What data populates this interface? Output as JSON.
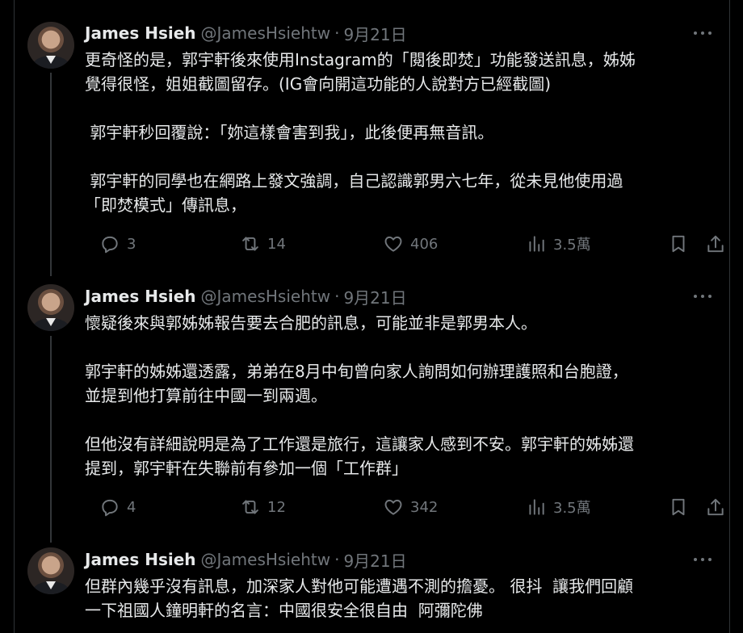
{
  "tweets": [
    {
      "name": "James Hsieh",
      "handle": "@JamesHsiehtw",
      "separator": "·",
      "time": "9月21日",
      "text": "更奇怪的是，郭宇軒後來使用Instagram的「閱後即焚」功能發送訊息，姊姊\n覺得很怪，姐姐截圖留存。(IG會向開這功能的人說對方已經截圖)\n\n 郭宇軒秒回覆說：「妳這樣會害到我」，此後便再無音訊。\n\n 郭宇軒的同學也在網路上發文強調，自己認識郭男六七年，從未見他使用過\n「即焚模式」傳訊息，",
      "replies": "3",
      "retweets": "14",
      "likes": "406",
      "views": "3.5萬"
    },
    {
      "name": "James Hsieh",
      "handle": "@JamesHsiehtw",
      "separator": "·",
      "time": "9月21日",
      "text": "懷疑後來與郭姊姊報告要去合肥的訊息，可能並非是郭男本人。\n\n郭宇軒的姊姊還透露，弟弟在8月中旬曾向家人詢問如何辦理護照和台胞證，\n並提到他打算前往中國一到兩週。\n\n但他沒有詳細說明是為了工作還是旅行，這讓家人感到不安。郭宇軒的姊姊還\n提到，郭宇軒在失聯前有參加一個「工作群」",
      "replies": "4",
      "retweets": "12",
      "likes": "342",
      "views": "3.5萬"
    },
    {
      "name": "James Hsieh",
      "handle": "@JamesHsiehtw",
      "separator": "·",
      "time": "9月21日",
      "text": "但群內幾乎沒有訊息，加深家人對他可能遭遇不測的擔憂。 很抖  讓我們回顧\n一下祖國人鐘明軒的名言：中國很安全很自由  阿彌陀佛"
    }
  ],
  "icons": {
    "reply": "reply-icon",
    "retweet": "retweet-icon",
    "like": "heart-icon",
    "views": "views-icon",
    "bookmark": "bookmark-icon",
    "share": "share-icon",
    "more": "more-icon"
  },
  "colors": {
    "background": "#000000",
    "text": "#e7e9ea",
    "muted": "#71767b",
    "thread_line": "#333639"
  }
}
